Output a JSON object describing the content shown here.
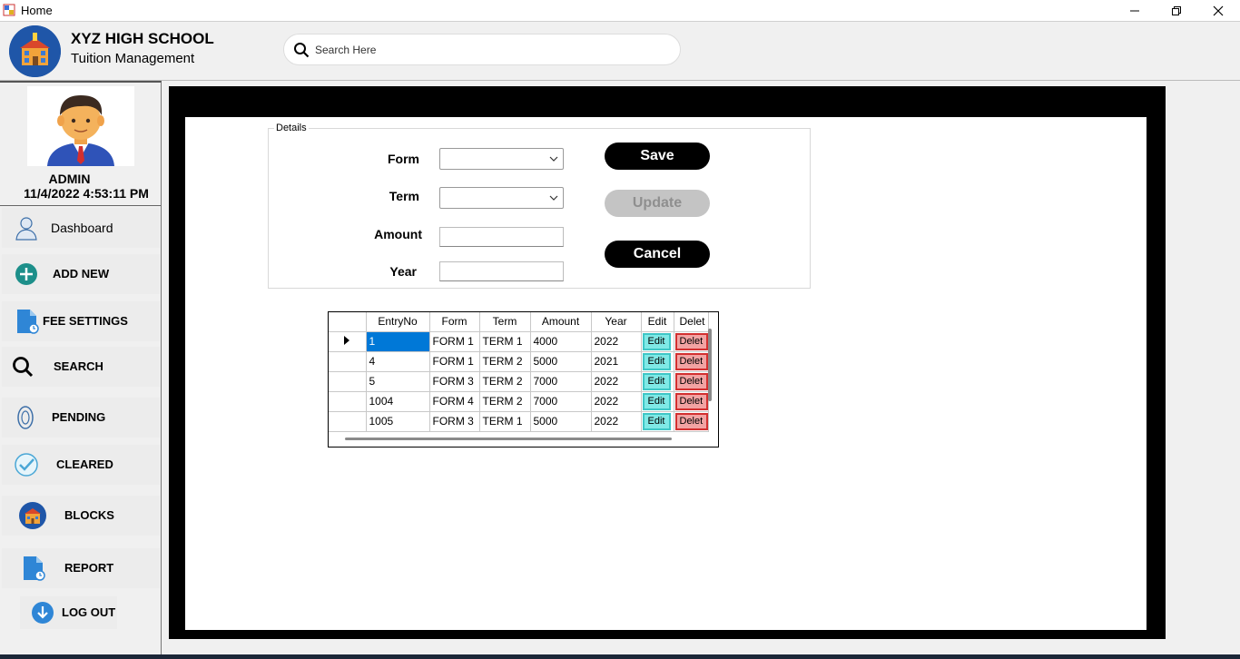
{
  "window": {
    "title": "Home",
    "icons": [
      "app-icon",
      "minimize-icon",
      "maximize-icon",
      "close-icon"
    ]
  },
  "header": {
    "school_name": "XYZ HIGH SCHOOL",
    "subtitle": "Tuition Management",
    "search_placeholder": "Search Here",
    "logo_icon": "school-building-icon"
  },
  "profile": {
    "name": "ADMIN",
    "datetime": "11/4/2022 4:53:11 PM",
    "avatar_icon": "user-avatar-icon"
  },
  "sidebar": {
    "items": [
      {
        "label": "Dashboard",
        "icon": "dashboard-user-icon"
      },
      {
        "label": "ADD NEW",
        "icon": "plus-circle-icon"
      },
      {
        "label": "FEE SETTINGS",
        "icon": "document-clock-icon"
      },
      {
        "label": "SEARCH",
        "icon": "search-icon"
      },
      {
        "label": "PENDING",
        "icon": "pending-icon"
      },
      {
        "label": "CLEARED",
        "icon": "check-circle-icon"
      },
      {
        "label": "BLOCKS",
        "icon": "school-building-icon"
      },
      {
        "label": "REPORT",
        "icon": "document-clock-icon"
      },
      {
        "label": "LOG OUT",
        "icon": "download-circle-icon"
      }
    ]
  },
  "details": {
    "legend": "Details",
    "form_label": "Form",
    "term_label": "Term",
    "amount_label": "Amount",
    "year_label": "Year",
    "form_value": "",
    "term_value": "",
    "amount_value": "",
    "year_value": "",
    "save_label": "Save",
    "update_label": "Update",
    "cancel_label": "Cancel"
  },
  "grid": {
    "columns": [
      "EntryNo",
      "Form",
      "Term",
      "Amount",
      "Year",
      "Edit",
      "Delet"
    ],
    "edit_label": "Edit",
    "delete_label": "Delet",
    "rows": [
      [
        "1",
        "FORM 1",
        "TERM 1",
        "4000",
        "2022"
      ],
      [
        "4",
        "FORM 1",
        "TERM 2",
        "5000",
        "2021"
      ],
      [
        "5",
        "FORM 3",
        "TERM 2",
        "7000",
        "2022"
      ],
      [
        "1004",
        "FORM 4",
        "TERM 2",
        "7000",
        "2022"
      ],
      [
        "1005",
        "FORM 3",
        "TERM 1",
        "5000",
        "2022"
      ]
    ]
  },
  "colors": {
    "save": "#000000",
    "update_disabled": "#c4c4c4",
    "edit": "#7fe9e6",
    "delete": "#f2a3a3",
    "selection": "#0078d7"
  }
}
